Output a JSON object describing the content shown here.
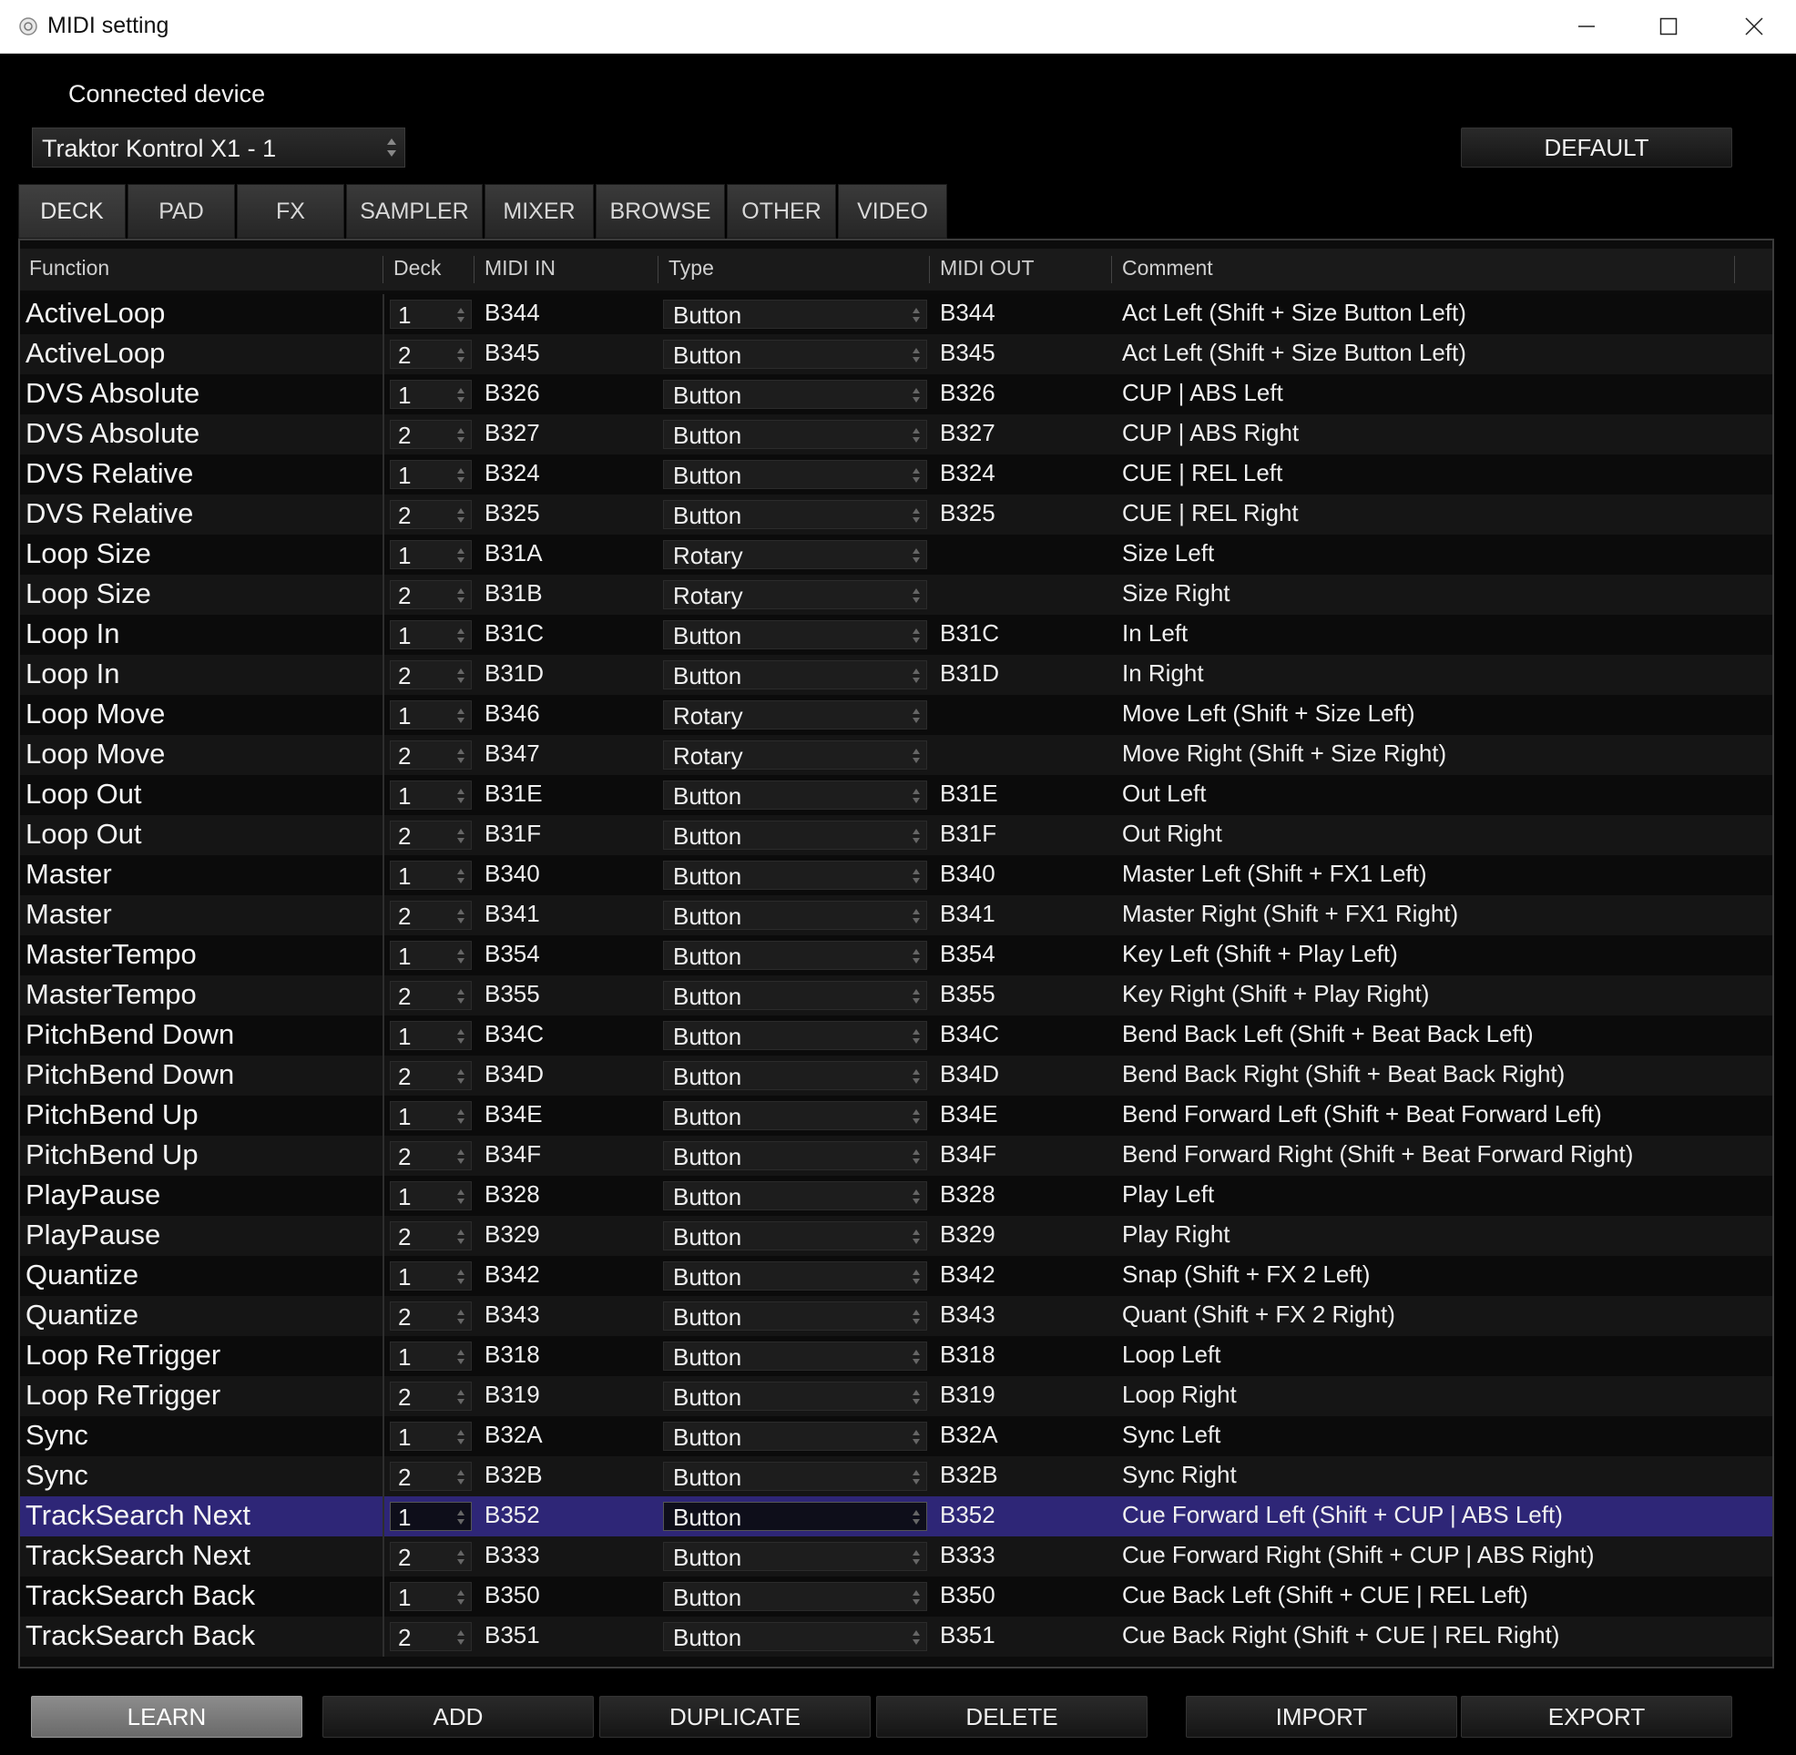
{
  "window": {
    "title": "MIDI setting",
    "controls": [
      "minimize",
      "maximize",
      "close"
    ]
  },
  "device": {
    "label": "Connected device",
    "selected": "Traktor Kontrol X1 - 1",
    "default_button": "DEFAULT"
  },
  "tabs": [
    {
      "label": "DECK",
      "active": true
    },
    {
      "label": "PAD"
    },
    {
      "label": "FX"
    },
    {
      "label": "SAMPLER"
    },
    {
      "label": "MIXER"
    },
    {
      "label": "BROWSE"
    },
    {
      "label": "OTHER"
    },
    {
      "label": "VIDEO"
    }
  ],
  "table": {
    "columns": [
      "Function",
      "Deck",
      "MIDI IN",
      "Type",
      "MIDI OUT",
      "Comment"
    ],
    "rows": [
      {
        "function": "ActiveLoop",
        "deck": "1",
        "midi_in": "B344",
        "type": "Button",
        "midi_out": "B344",
        "comment": "Act Left (Shift + Size Button Left)"
      },
      {
        "function": "ActiveLoop",
        "deck": "2",
        "midi_in": "B345",
        "type": "Button",
        "midi_out": "B345",
        "comment": "Act Left (Shift + Size Button Left)"
      },
      {
        "function": "DVS Absolute",
        "deck": "1",
        "midi_in": "B326",
        "type": "Button",
        "midi_out": "B326",
        "comment": "CUP | ABS Left"
      },
      {
        "function": "DVS Absolute",
        "deck": "2",
        "midi_in": "B327",
        "type": "Button",
        "midi_out": "B327",
        "comment": "CUP | ABS Right"
      },
      {
        "function": "DVS Relative",
        "deck": "1",
        "midi_in": "B324",
        "type": "Button",
        "midi_out": "B324",
        "comment": "CUE | REL Left"
      },
      {
        "function": "DVS Relative",
        "deck": "2",
        "midi_in": "B325",
        "type": "Button",
        "midi_out": "B325",
        "comment": "CUE | REL Right"
      },
      {
        "function": "Loop Size",
        "deck": "1",
        "midi_in": "B31A",
        "type": "Rotary",
        "midi_out": "",
        "comment": "Size Left"
      },
      {
        "function": "Loop Size",
        "deck": "2",
        "midi_in": "B31B",
        "type": "Rotary",
        "midi_out": "",
        "comment": "Size Right"
      },
      {
        "function": "Loop In",
        "deck": "1",
        "midi_in": "B31C",
        "type": "Button",
        "midi_out": "B31C",
        "comment": "In Left"
      },
      {
        "function": "Loop In",
        "deck": "2",
        "midi_in": "B31D",
        "type": "Button",
        "midi_out": "B31D",
        "comment": "In Right"
      },
      {
        "function": "Loop Move",
        "deck": "1",
        "midi_in": "B346",
        "type": "Rotary",
        "midi_out": "",
        "comment": "Move Left (Shift + Size Left)"
      },
      {
        "function": "Loop Move",
        "deck": "2",
        "midi_in": "B347",
        "type": "Rotary",
        "midi_out": "",
        "comment": "Move Right (Shift + Size Right)"
      },
      {
        "function": "Loop Out",
        "deck": "1",
        "midi_in": "B31E",
        "type": "Button",
        "midi_out": "B31E",
        "comment": "Out Left"
      },
      {
        "function": "Loop Out",
        "deck": "2",
        "midi_in": "B31F",
        "type": "Button",
        "midi_out": "B31F",
        "comment": "Out Right"
      },
      {
        "function": "Master",
        "deck": "1",
        "midi_in": "B340",
        "type": "Button",
        "midi_out": "B340",
        "comment": "Master Left (Shift + FX1 Left)"
      },
      {
        "function": "Master",
        "deck": "2",
        "midi_in": "B341",
        "type": "Button",
        "midi_out": "B341",
        "comment": "Master Right (Shift + FX1 Right)"
      },
      {
        "function": "MasterTempo",
        "deck": "1",
        "midi_in": "B354",
        "type": "Button",
        "midi_out": "B354",
        "comment": "Key Left (Shift + Play Left)"
      },
      {
        "function": "MasterTempo",
        "deck": "2",
        "midi_in": "B355",
        "type": "Button",
        "midi_out": "B355",
        "comment": "Key Right (Shift + Play Right)"
      },
      {
        "function": "PitchBend Down",
        "deck": "1",
        "midi_in": "B34C",
        "type": "Button",
        "midi_out": "B34C",
        "comment": "Bend Back Left (Shift + Beat Back Left)"
      },
      {
        "function": "PitchBend Down",
        "deck": "2",
        "midi_in": "B34D",
        "type": "Button",
        "midi_out": "B34D",
        "comment": "Bend Back Right (Shift + Beat Back Right)"
      },
      {
        "function": "PitchBend Up",
        "deck": "1",
        "midi_in": "B34E",
        "type": "Button",
        "midi_out": "B34E",
        "comment": "Bend Forward Left (Shift + Beat Forward Left)"
      },
      {
        "function": "PitchBend Up",
        "deck": "2",
        "midi_in": "B34F",
        "type": "Button",
        "midi_out": "B34F",
        "comment": "Bend Forward Right (Shift + Beat Forward Right)"
      },
      {
        "function": "PlayPause",
        "deck": "1",
        "midi_in": "B328",
        "type": "Button",
        "midi_out": "B328",
        "comment": "Play Left"
      },
      {
        "function": "PlayPause",
        "deck": "2",
        "midi_in": "B329",
        "type": "Button",
        "midi_out": "B329",
        "comment": "Play Right"
      },
      {
        "function": "Quantize",
        "deck": "1",
        "midi_in": "B342",
        "type": "Button",
        "midi_out": "B342",
        "comment": "Snap (Shift + FX 2 Left)"
      },
      {
        "function": "Quantize",
        "deck": "2",
        "midi_in": "B343",
        "type": "Button",
        "midi_out": "B343",
        "comment": "Quant (Shift + FX 2 Right)"
      },
      {
        "function": "Loop ReTrigger",
        "deck": "1",
        "midi_in": "B318",
        "type": "Button",
        "midi_out": "B318",
        "comment": "Loop Left"
      },
      {
        "function": "Loop ReTrigger",
        "deck": "2",
        "midi_in": "B319",
        "type": "Button",
        "midi_out": "B319",
        "comment": "Loop Right"
      },
      {
        "function": "Sync",
        "deck": "1",
        "midi_in": "B32A",
        "type": "Button",
        "midi_out": "B32A",
        "comment": "Sync Left"
      },
      {
        "function": "Sync",
        "deck": "2",
        "midi_in": "B32B",
        "type": "Button",
        "midi_out": "B32B",
        "comment": "Sync Right"
      },
      {
        "function": "TrackSearch Next",
        "deck": "1",
        "midi_in": "B352",
        "type": "Button",
        "midi_out": "B352",
        "comment": "Cue Forward Left (Shift + CUP | ABS Left)",
        "selected": true
      },
      {
        "function": "TrackSearch Next",
        "deck": "2",
        "midi_in": "B333",
        "type": "Button",
        "midi_out": "B333",
        "comment": "Cue Forward Right (Shift + CUP | ABS Right)"
      },
      {
        "function": "TrackSearch Back",
        "deck": "1",
        "midi_in": "B350",
        "type": "Button",
        "midi_out": "B350",
        "comment": "Cue Back Left (Shift + CUE | REL Left)"
      },
      {
        "function": "TrackSearch Back",
        "deck": "2",
        "midi_in": "B351",
        "type": "Button",
        "midi_out": "B351",
        "comment": "Cue Back Right (Shift + CUE | REL Right)"
      }
    ]
  },
  "actions": {
    "learn": "LEARN",
    "add": "ADD",
    "duplicate": "DUPLICATE",
    "delete": "DELETE",
    "import": "IMPORT",
    "export": "EXPORT"
  },
  "colors": {
    "background": "#000000",
    "selected_row": "#2e2677",
    "learn_button": "#7a7a7a"
  }
}
